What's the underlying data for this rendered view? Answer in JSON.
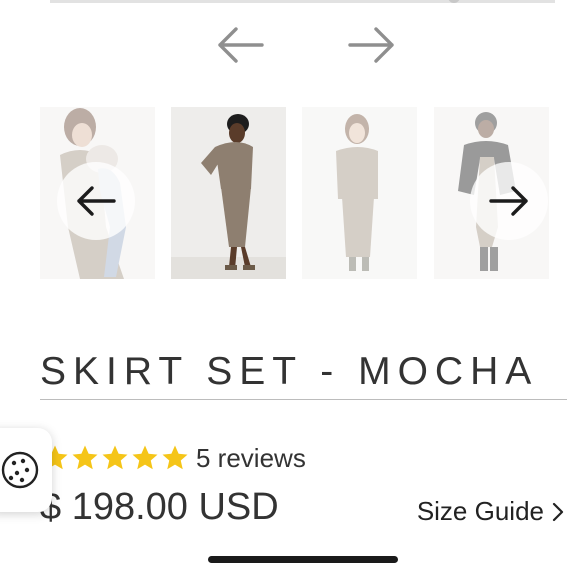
{
  "product": {
    "title": "SKIRT SET - MOCHA",
    "rating_stars": 5,
    "reviews_label": "5 reviews",
    "price": "$ 198.00 USD",
    "size_guide_label": "Size Guide"
  },
  "gallery": {
    "main_prev_icon": "arrow-left-icon",
    "main_next_icon": "arrow-right-icon",
    "thumbnails": [
      {
        "subject": "woman-holding-child",
        "state": "faded"
      },
      {
        "subject": "model-in-mocha-set",
        "state": "active"
      },
      {
        "subject": "model-in-mocha-set-front",
        "state": "faded"
      },
      {
        "subject": "model-with-black-blazer",
        "state": "faded"
      }
    ]
  },
  "colors": {
    "star": "#f5c518",
    "text": "#333333",
    "rule": "#bcbcbc",
    "mocha": "#a39484"
  }
}
